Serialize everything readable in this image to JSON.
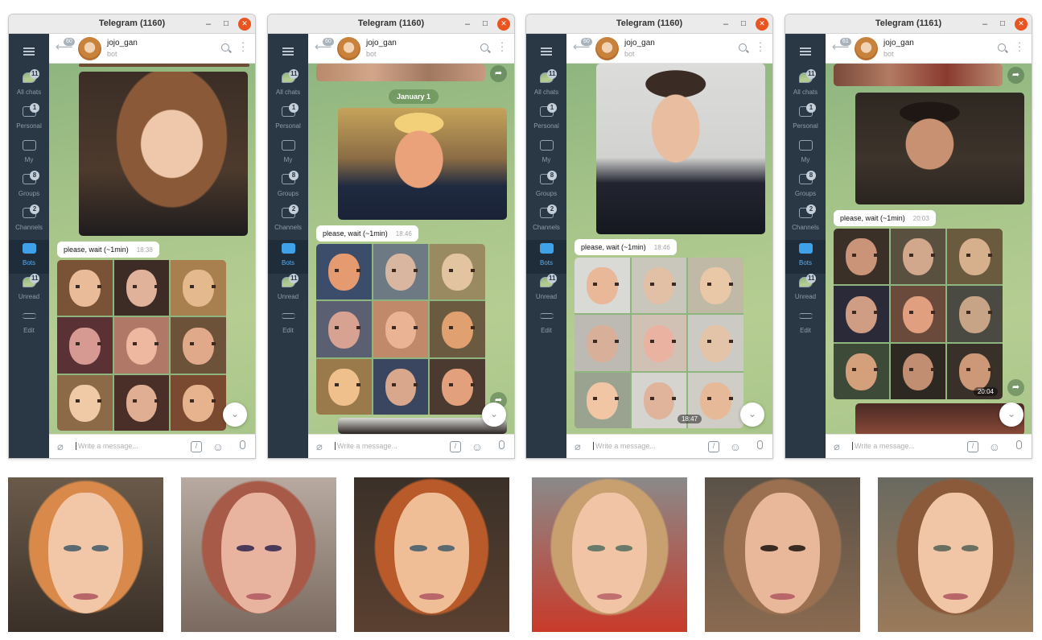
{
  "windows": [
    {
      "title": "Telegram (1160)",
      "header": {
        "back_count": "60",
        "name": "jojo_gan",
        "subtitle": "bot"
      },
      "folders": [
        {
          "label": "All chats",
          "badge": "11"
        },
        {
          "label": "Personal",
          "badge": "1"
        },
        {
          "label": "My",
          "badge": ""
        },
        {
          "label": "Groups",
          "badge": "8"
        },
        {
          "label": "Channels",
          "badge": "2"
        },
        {
          "label": "Bots",
          "badge": "",
          "active": true
        },
        {
          "label": "Unread",
          "badge": "11"
        },
        {
          "label": "Edit",
          "badge": ""
        }
      ],
      "message": {
        "text": "please, wait (~1min)",
        "time": "18:38"
      },
      "date_pill": "",
      "grid_time": "",
      "input_placeholder": "Write a message..."
    },
    {
      "title": "Telegram (1160)",
      "header": {
        "back_count": "60",
        "name": "jojo_gan",
        "subtitle": "bot"
      },
      "folders": [
        {
          "label": "All chats",
          "badge": "11"
        },
        {
          "label": "Personal",
          "badge": "1"
        },
        {
          "label": "My",
          "badge": ""
        },
        {
          "label": "Groups",
          "badge": "8"
        },
        {
          "label": "Channels",
          "badge": "2"
        },
        {
          "label": "Bots",
          "badge": "",
          "active": true
        },
        {
          "label": "Unread",
          "badge": "11"
        },
        {
          "label": "Edit",
          "badge": ""
        }
      ],
      "message": {
        "text": "please, wait (~1min)",
        "time": "18:46"
      },
      "date_pill": "January 1",
      "grid_time": "",
      "input_placeholder": "Write a message..."
    },
    {
      "title": "Telegram (1160)",
      "header": {
        "back_count": "60",
        "name": "jojo_gan",
        "subtitle": "bot"
      },
      "folders": [
        {
          "label": "All chats",
          "badge": "11"
        },
        {
          "label": "Personal",
          "badge": "1"
        },
        {
          "label": "My",
          "badge": ""
        },
        {
          "label": "Groups",
          "badge": "8"
        },
        {
          "label": "Channels",
          "badge": "2"
        },
        {
          "label": "Bots",
          "badge": "",
          "active": true
        },
        {
          "label": "Unread",
          "badge": "11"
        },
        {
          "label": "Edit",
          "badge": ""
        }
      ],
      "message": {
        "text": "please, wait (~1min)",
        "time": "18:46"
      },
      "date_pill": "",
      "grid_time": "18:47",
      "input_placeholder": "Write a message..."
    },
    {
      "title": "Telegram (1161)",
      "header": {
        "back_count": "61",
        "name": "jojo_gan",
        "subtitle": "bot"
      },
      "folders": [
        {
          "label": "All chats",
          "badge": "11"
        },
        {
          "label": "Personal",
          "badge": "1"
        },
        {
          "label": "My",
          "badge": ""
        },
        {
          "label": "Groups",
          "badge": "8"
        },
        {
          "label": "Channels",
          "badge": "2"
        },
        {
          "label": "Bots",
          "badge": "",
          "active": true
        },
        {
          "label": "Unread",
          "badge": "11"
        },
        {
          "label": "Edit",
          "badge": ""
        }
      ],
      "message": {
        "text": "please, wait (~1min)",
        "time": "20:03"
      },
      "date_pill": "",
      "grid_time": "20:04",
      "input_placeholder": "Write a message..."
    }
  ],
  "icons": {
    "menu": "hamburger-icon",
    "back": "back-arrow-icon",
    "search": "search-icon",
    "more": "more-vertical-icon",
    "attach": "paperclip-icon",
    "commands": "slash-command-icon",
    "emoji": "emoji-icon",
    "voice": "microphone-icon",
    "forward": "forward-icon",
    "scroll_down": "chevron-down-icon"
  },
  "colors": {
    "sidebar": "#2a3845",
    "active_folder": "#3fa2e8",
    "close_button": "#e95420",
    "chat_bg": "#a7c58a"
  }
}
